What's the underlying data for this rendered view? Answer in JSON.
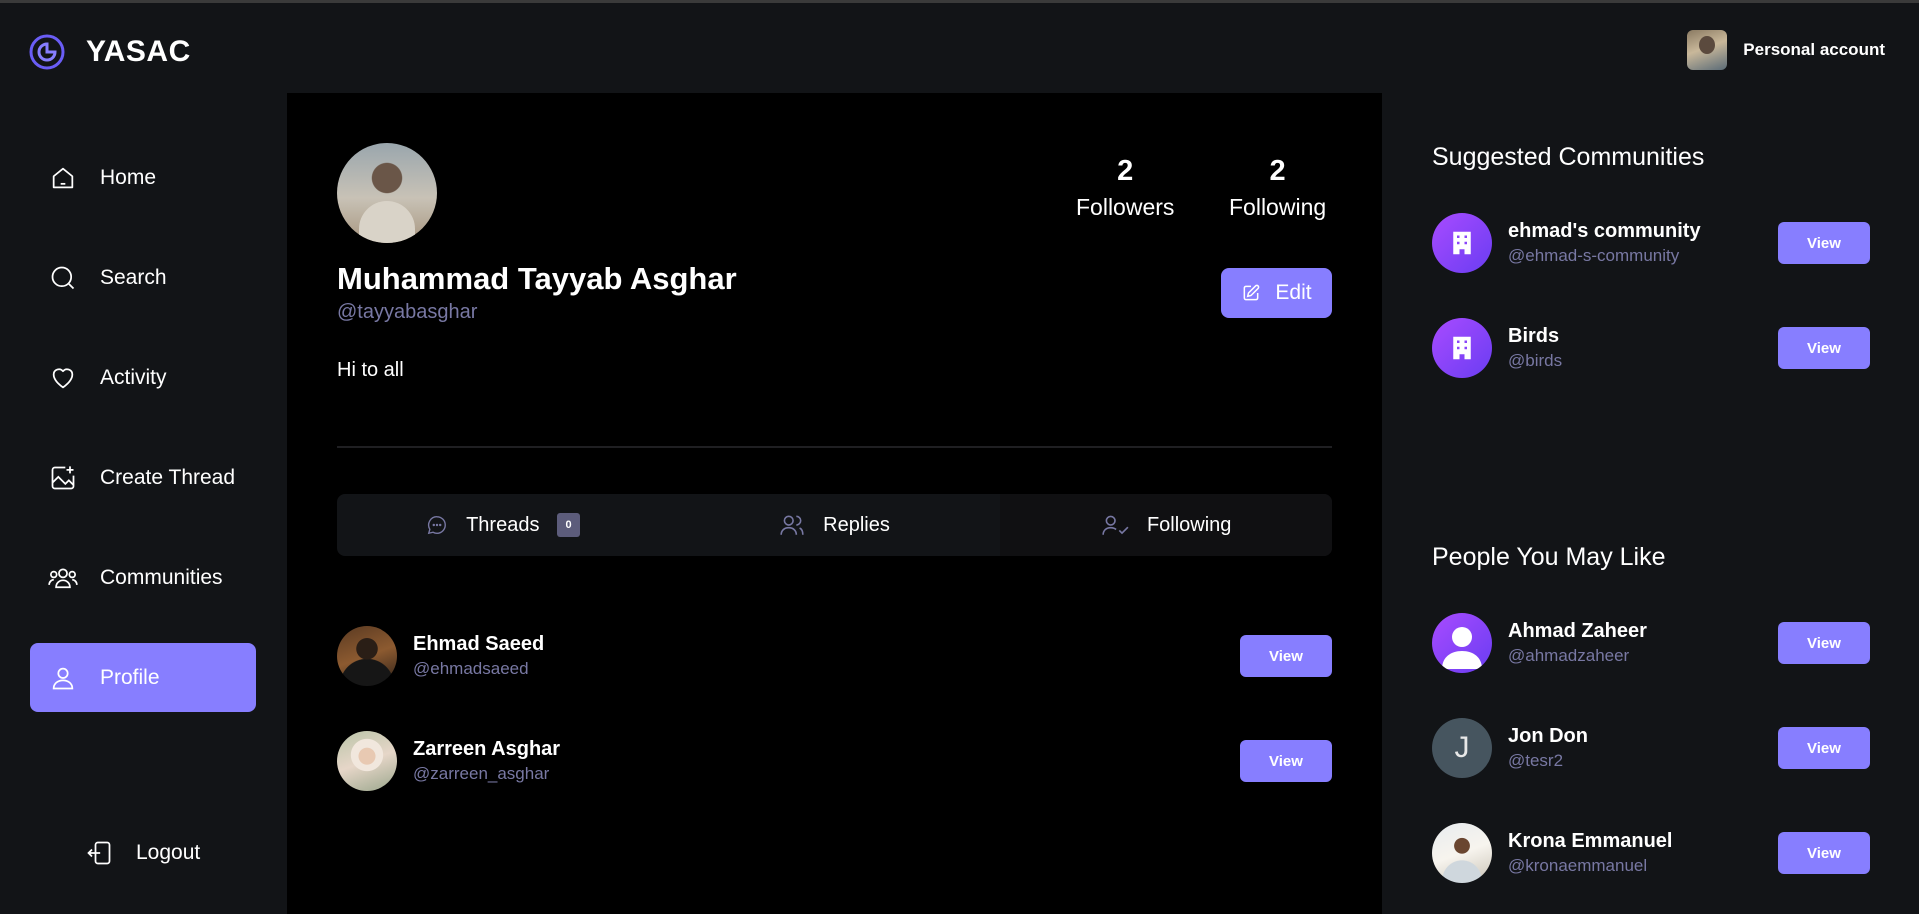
{
  "app": {
    "name": "YASAC",
    "account_label": "Personal account"
  },
  "sidebar": {
    "items": [
      {
        "label": "Home",
        "icon": "home-icon"
      },
      {
        "label": "Search",
        "icon": "search-icon"
      },
      {
        "label": "Activity",
        "icon": "heart-icon"
      },
      {
        "label": "Create Thread",
        "icon": "image-plus-icon"
      },
      {
        "label": "Communities",
        "icon": "users-icon"
      },
      {
        "label": "Profile",
        "icon": "user-icon",
        "active": true
      }
    ],
    "logout_label": "Logout"
  },
  "profile": {
    "name": "Muhammad Tayyab Asghar",
    "handle": "@tayyabasghar",
    "bio": "Hi to all",
    "followers_count": "2",
    "followers_label": "Followers",
    "following_count": "2",
    "following_label": "Following",
    "edit_label": "Edit"
  },
  "tabs": [
    {
      "label": "Threads",
      "badge": "0",
      "icon": "message-circle-icon"
    },
    {
      "label": "Replies",
      "icon": "users-icon"
    },
    {
      "label": "Following",
      "icon": "user-check-icon",
      "active": true
    }
  ],
  "following_list": [
    {
      "name": "Ehmad Saeed",
      "handle": "@ehmadsaeed",
      "button": "View"
    },
    {
      "name": "Zarreen Asghar",
      "handle": "@zarreen_asghar",
      "button": "View"
    }
  ],
  "suggested_communities": {
    "title": "Suggested Communities",
    "items": [
      {
        "name": "ehmad's community",
        "handle": "@ehmad-s-community",
        "button": "View"
      },
      {
        "name": "Birds",
        "handle": "@birds",
        "button": "View"
      }
    ]
  },
  "people_you_may_like": {
    "title": "People You May Like",
    "items": [
      {
        "name": "Ahmad Zaheer",
        "handle": "@ahmadzaheer",
        "button": "View"
      },
      {
        "name": "Jon Don",
        "handle": "@tesr2",
        "button": "View",
        "initial": "J"
      },
      {
        "name": "Krona Emmanuel",
        "handle": "@kronaemmanuel",
        "button": "View"
      }
    ]
  },
  "colors": {
    "accent": "#877eff",
    "background": "#121417",
    "main": "#000000",
    "muted": "#7878a3"
  }
}
